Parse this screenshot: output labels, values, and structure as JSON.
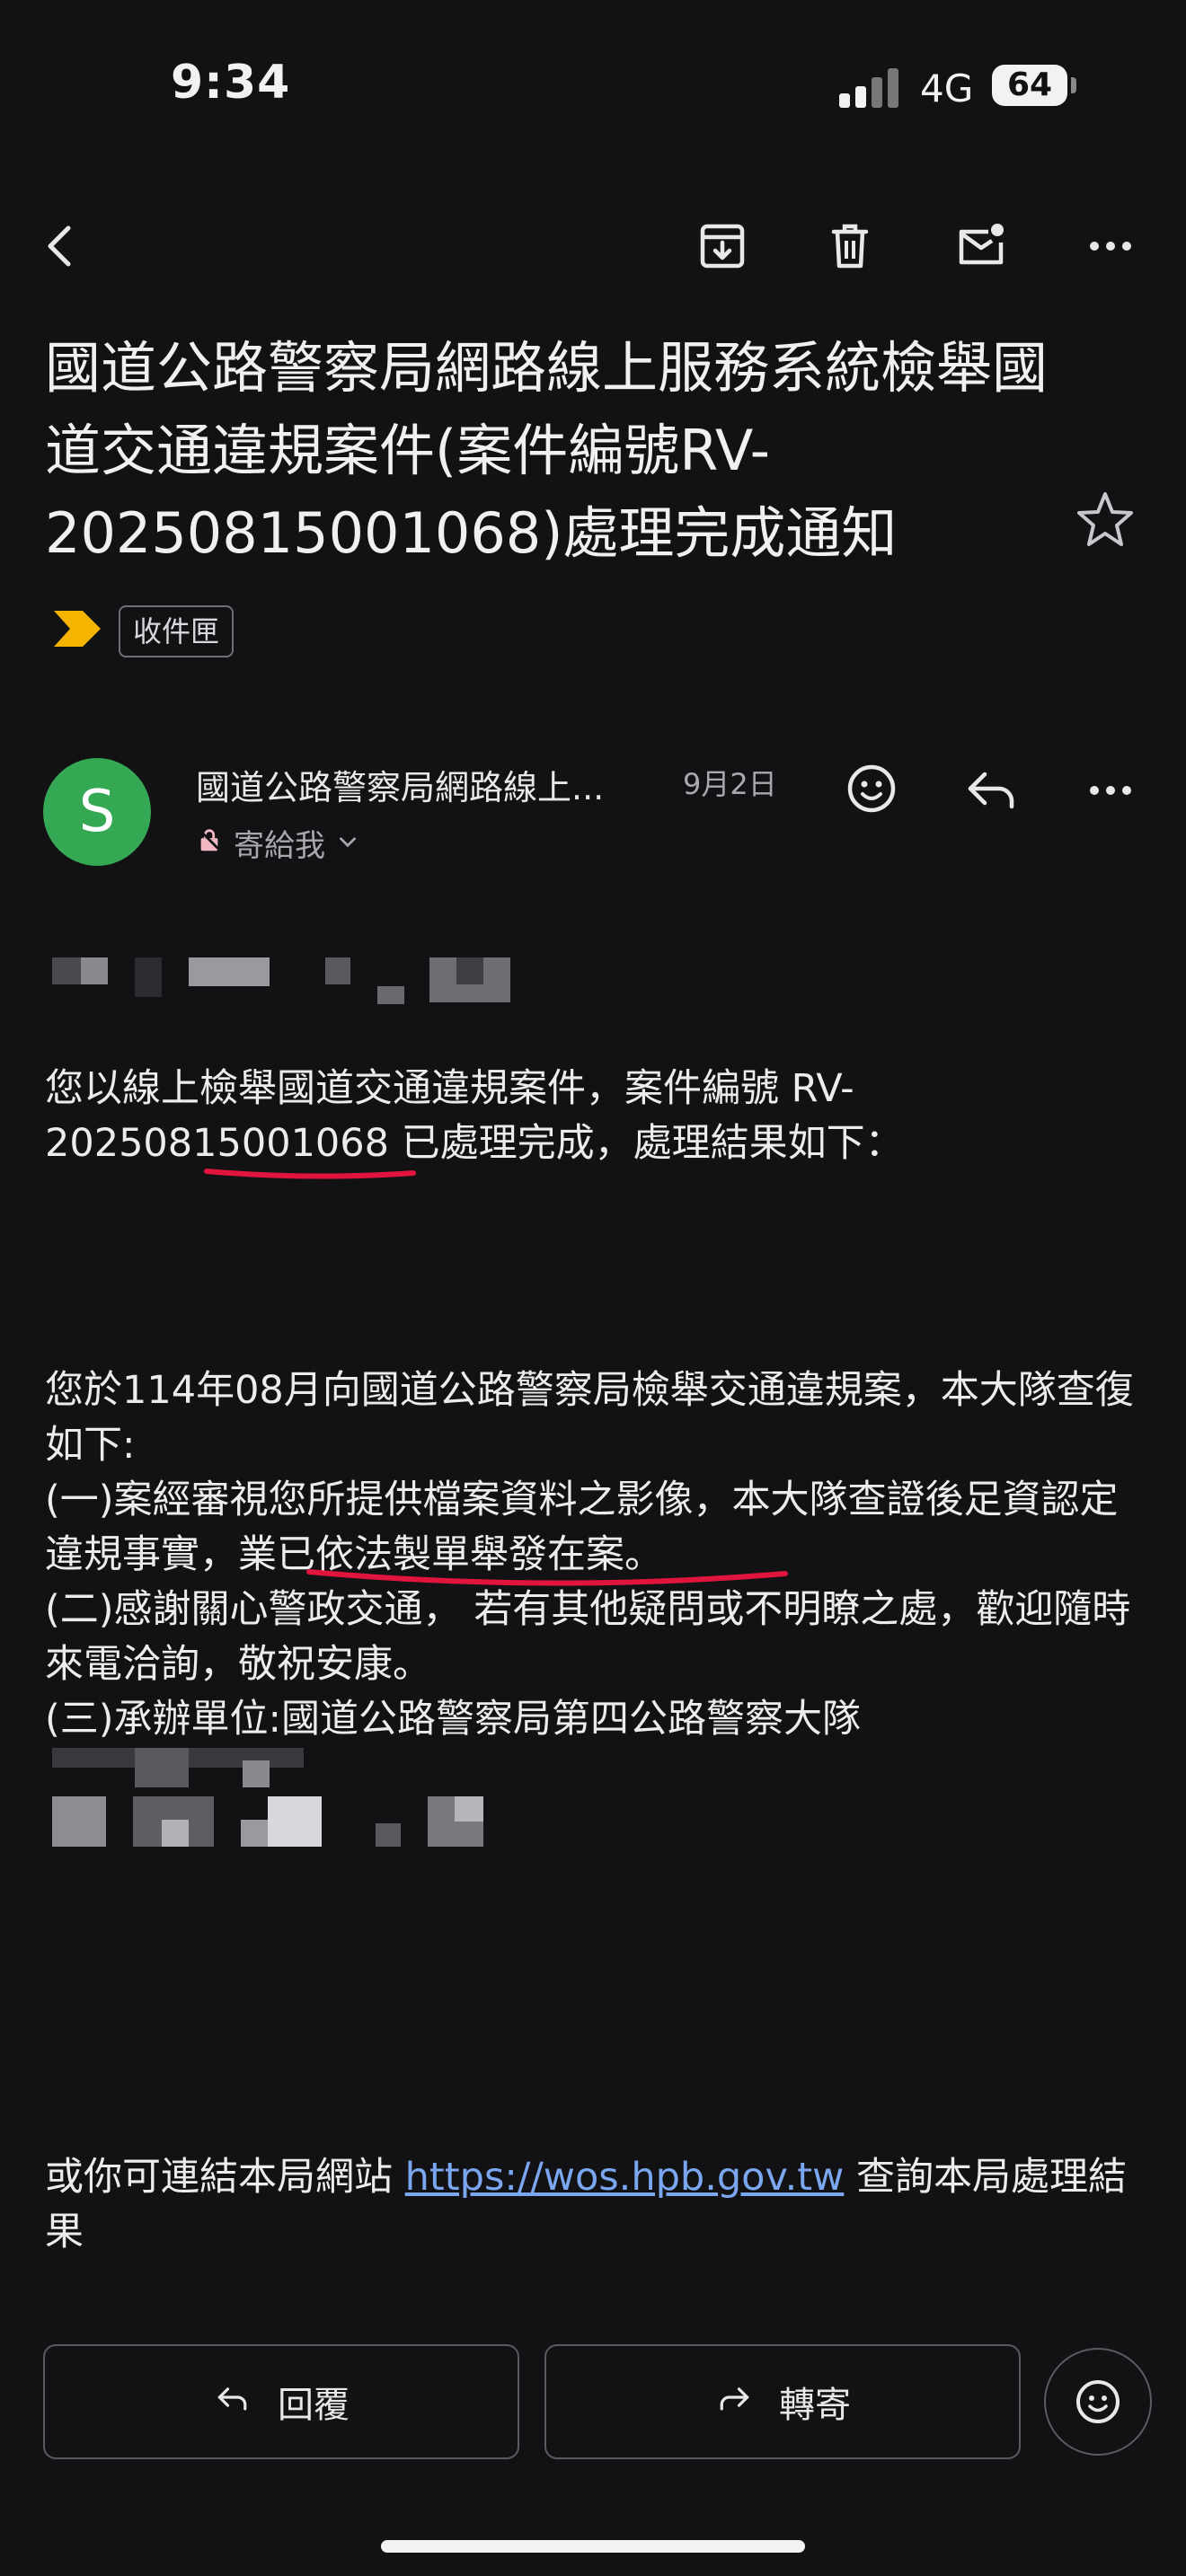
{
  "status_bar": {
    "time": "9:34",
    "network": "4G",
    "battery": "64"
  },
  "toolbar": {
    "icons": [
      "back-icon",
      "archive-icon",
      "delete-icon",
      "mark-unread-icon",
      "more-icon"
    ]
  },
  "email": {
    "subject": "國道公路警察局網路線上服務系統檢舉國道交通違規案件(案件編號RV-20250815001068)處理完成通知",
    "label": "收件匣",
    "sender": {
      "avatar_letter": "S",
      "avatar_color": "#34a853",
      "name": "國道公路警察局網路線上...",
      "date": "9月2日",
      "to": "寄給我"
    },
    "body": {
      "para1": "您以線上檢舉國道交通違規案件，案件編號 RV-20250815001068 已處理完成，處理結果如下：",
      "para2": [
        "您於114年08月向國道公路警察局檢舉交通違規案，本大隊查復如下:",
        "(一)案經審視您所提供檔案資料之影像，本大隊查證後足資認定違規事實，業已依法製單舉發在案。",
        "(二)感謝關心警政交通， 若有其他疑問或不明瞭之處，歡迎隨時來電洽詢，敬祝安康。",
        "(三)承辦單位:國道公路警察局第四公路警察大隊"
      ],
      "link_prefix": "或你可連結本局網站 ",
      "link_text": "https://wos.hpb.gov.tw",
      "link_suffix": " 查詢本局處理結果"
    }
  },
  "actions": {
    "reply": "回覆",
    "forward": "轉寄"
  },
  "colors": {
    "background": "#121214",
    "link": "#7aa7ef",
    "annotation_red": "#e0143c",
    "label_arrow": "#f4b400"
  }
}
